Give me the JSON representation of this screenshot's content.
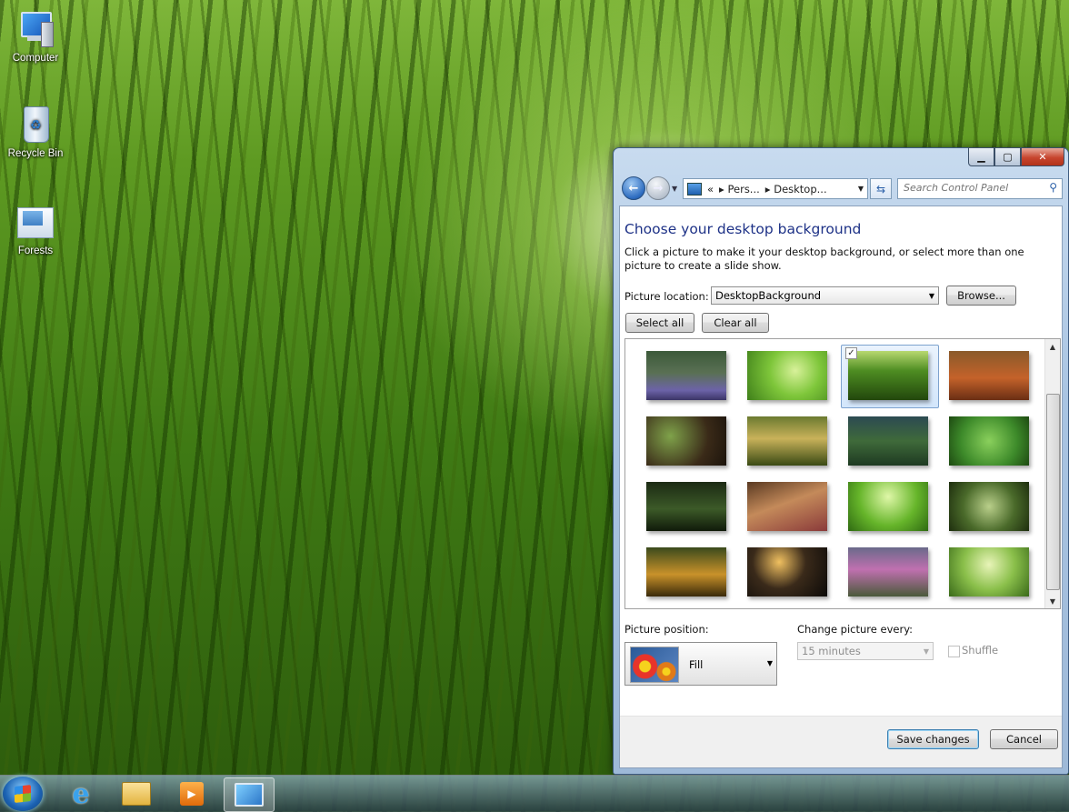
{
  "desktop": {
    "icons": [
      {
        "label": "Computer",
        "icon": "computer-icon"
      },
      {
        "label": "Recycle Bin",
        "icon": "recycle-bin-icon"
      },
      {
        "label": "Forests",
        "icon": "folder-icon"
      }
    ]
  },
  "window": {
    "caption_buttons": {
      "minimize": "▁",
      "maximize": "▢",
      "close": "✕"
    },
    "address": {
      "overflow": "«",
      "crumbs": [
        "Pers...",
        "Desktop..."
      ]
    },
    "search": {
      "placeholder": "Search Control Panel"
    },
    "heading": "Choose your desktop background",
    "description": "Click a picture to make it your desktop background, or select more than one picture to create a slide show.",
    "picture_location": {
      "label": "Picture location:",
      "value": "DesktopBackground",
      "browse": "Browse..."
    },
    "select_all": "Select all",
    "clear_all": "Clear all",
    "gallery": {
      "selected_index": 2,
      "thumbnails": [
        {
          "name": "thumb-bluebell-forest",
          "checked": false
        },
        {
          "name": "thumb-green-leaves",
          "checked": false
        },
        {
          "name": "thumb-bamboo-forest",
          "checked": true
        },
        {
          "name": "thumb-autumn-forest",
          "checked": false
        },
        {
          "name": "thumb-fern-bokeh",
          "checked": false
        },
        {
          "name": "thumb-sunlit-forest-path",
          "checked": false
        },
        {
          "name": "thumb-pine-forest",
          "checked": false
        },
        {
          "name": "thumb-fern-closeup",
          "checked": false
        },
        {
          "name": "thumb-dark-stream",
          "checked": false
        },
        {
          "name": "thumb-autumn-path",
          "checked": false
        },
        {
          "name": "thumb-bright-canopy",
          "checked": false
        },
        {
          "name": "thumb-misty-arch",
          "checked": false
        },
        {
          "name": "thumb-golden-forest",
          "checked": false
        },
        {
          "name": "thumb-forest-creek",
          "checked": false
        },
        {
          "name": "thumb-blossom-forest",
          "checked": false
        },
        {
          "name": "thumb-green-meadow",
          "checked": false
        }
      ]
    },
    "picture_position": {
      "label": "Picture position:",
      "value": "Fill"
    },
    "change_picture": {
      "label": "Change picture every:",
      "value": "15 minutes"
    },
    "shuffle": {
      "label": "Shuffle",
      "checked": false
    },
    "save": "Save changes",
    "cancel": "Cancel"
  },
  "taskbar": {
    "items": [
      "start-orb",
      "internet-explorer-icon",
      "windows-explorer-icon",
      "media-player-icon",
      "personalization-icon"
    ],
    "active": "personalization-icon"
  }
}
